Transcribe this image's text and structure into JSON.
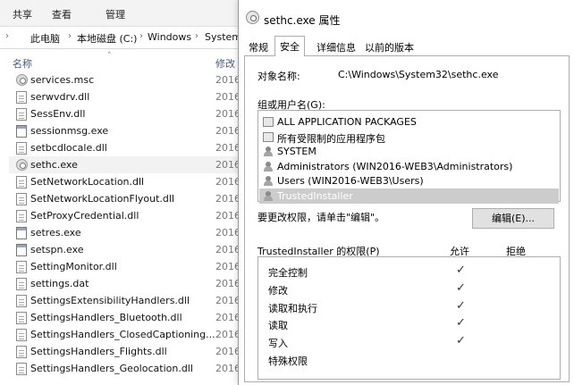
{
  "ribbon": {
    "tabs": [
      "共享",
      "查看",
      "管理"
    ]
  },
  "address": {
    "crumbs": [
      "此电脑",
      "本地磁盘 (C:)",
      "Windows",
      "System"
    ]
  },
  "columns": {
    "name": "名称",
    "date": "修改"
  },
  "files": [
    {
      "name": "services.msc",
      "date": "2016",
      "icon": "msc-file-icon"
    },
    {
      "name": "serwvdrv.dll",
      "date": "2016",
      "icon": "dll-file-icon"
    },
    {
      "name": "SessEnv.dll",
      "date": "2016",
      "icon": "dll-file-icon"
    },
    {
      "name": "sessionmsg.exe",
      "date": "2016",
      "icon": "exe-app-icon"
    },
    {
      "name": "setbcdlocale.dll",
      "date": "2016",
      "icon": "dll-file-icon"
    },
    {
      "name": "sethc.exe",
      "date": "2016",
      "icon": "sethc-gear-icon",
      "selected": true
    },
    {
      "name": "SetNetworkLocation.dll",
      "date": "2016",
      "icon": "dll-file-icon"
    },
    {
      "name": "SetNetworkLocationFlyout.dll",
      "date": "2016",
      "icon": "dll-file-icon"
    },
    {
      "name": "SetProxyCredential.dll",
      "date": "2016",
      "icon": "dll-file-icon"
    },
    {
      "name": "setres.exe",
      "date": "2016",
      "icon": "exe-app-icon"
    },
    {
      "name": "setspn.exe",
      "date": "2016",
      "icon": "exe-app-icon"
    },
    {
      "name": "SettingMonitor.dll",
      "date": "2016",
      "icon": "dll-file-icon"
    },
    {
      "name": "settings.dat",
      "date": "2016",
      "icon": "dat-file-icon"
    },
    {
      "name": "SettingsExtensibilityHandlers.dll",
      "date": "2016",
      "icon": "dll-file-icon"
    },
    {
      "name": "SettingsHandlers_Bluetooth.dll",
      "date": "2016",
      "icon": "dll-file-icon"
    },
    {
      "name": "SettingsHandlers_ClosedCaptioning....",
      "date": "2016",
      "icon": "dll-file-icon"
    },
    {
      "name": "SettingsHandlers_Flights.dll",
      "date": "2016",
      "icon": "dll-file-icon"
    },
    {
      "name": "SettingsHandlers_Geolocation.dll",
      "date": "2016",
      "icon": "dll-file-icon"
    }
  ],
  "dialog": {
    "title": "sethc.exe 属性",
    "tabs": [
      "常规",
      "安全",
      "详细信息",
      "以前的版本"
    ],
    "active_tab": "安全",
    "object_label": "对象名称:",
    "object_value": "C:\\Windows\\System32\\sethc.exe",
    "group_label": "组或用户名(G):",
    "users": [
      {
        "name": "ALL APPLICATION PACKAGES",
        "icon": "package-icon"
      },
      {
        "name": "所有受限制的应用程序包",
        "icon": "package-icon"
      },
      {
        "name": "SYSTEM",
        "icon": "user-group-icon"
      },
      {
        "name": "Administrators (WIN2016-WEB3\\Administrators)",
        "icon": "user-group-icon"
      },
      {
        "name": "Users (WIN2016-WEB3\\Users)",
        "icon": "user-group-icon"
      },
      {
        "name": "TrustedInstaller",
        "icon": "user-group-icon",
        "selected": true
      }
    ],
    "change_note": "要更改权限，请单击\"编辑\"。",
    "edit_button": "编辑(E)...",
    "perm_label": "TrustedInstaller 的权限(P)",
    "allow_header": "允许",
    "deny_header": "拒绝",
    "permissions": [
      {
        "name": "完全控制",
        "allow": "✓",
        "deny": ""
      },
      {
        "name": "修改",
        "allow": "✓",
        "deny": ""
      },
      {
        "name": "读取和执行",
        "allow": "✓",
        "deny": ""
      },
      {
        "name": "读取",
        "allow": "✓",
        "deny": ""
      },
      {
        "name": "写入",
        "allow": "✓",
        "deny": ""
      },
      {
        "name": "特殊权限",
        "allow": "",
        "deny": ""
      }
    ]
  }
}
